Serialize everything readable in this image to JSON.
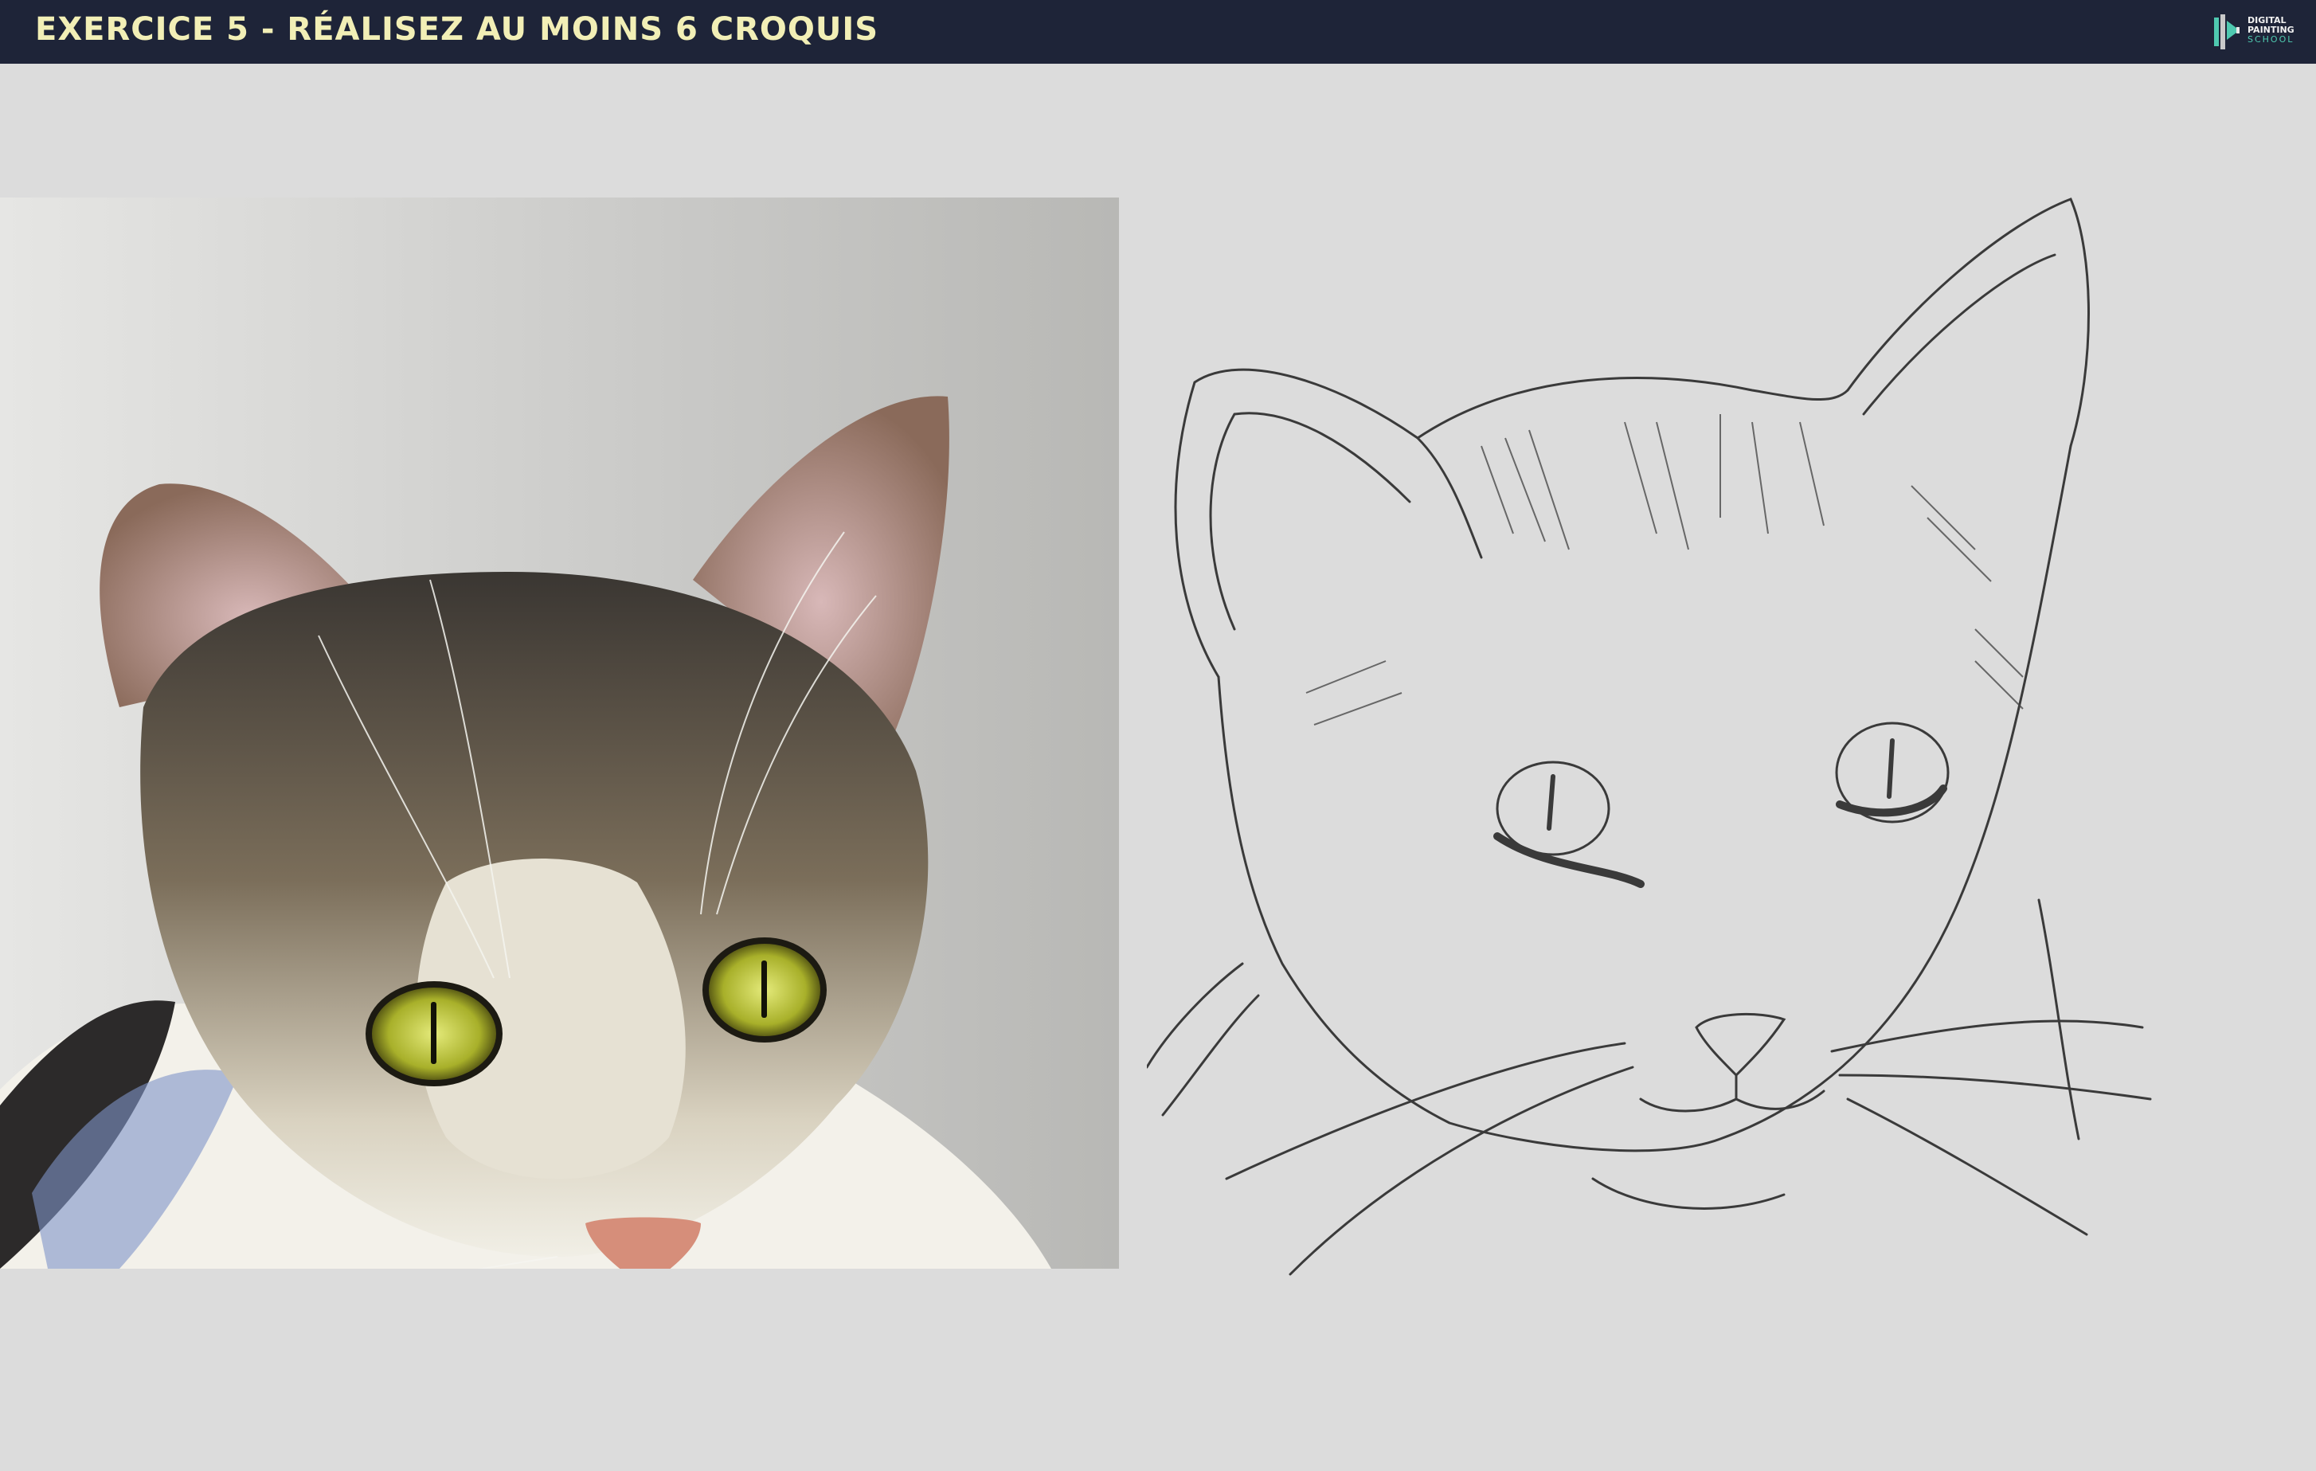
{
  "header": {
    "title": "EXERCICE 5 - RÉALISEZ AU MOINS 6 CROQUIS",
    "logo": {
      "line1": "DIGITAL",
      "line2": "PAINTING",
      "line3": "SCHOOL"
    }
  },
  "colors": {
    "header_bg": "#1e2438",
    "title_text": "#f2efb6",
    "logo_accent": "#4fc9b0",
    "page_bg": "#dcdcdc"
  },
  "images": {
    "reference_photo": "cat-portrait-photo",
    "sketch": "cat-line-sketch"
  }
}
